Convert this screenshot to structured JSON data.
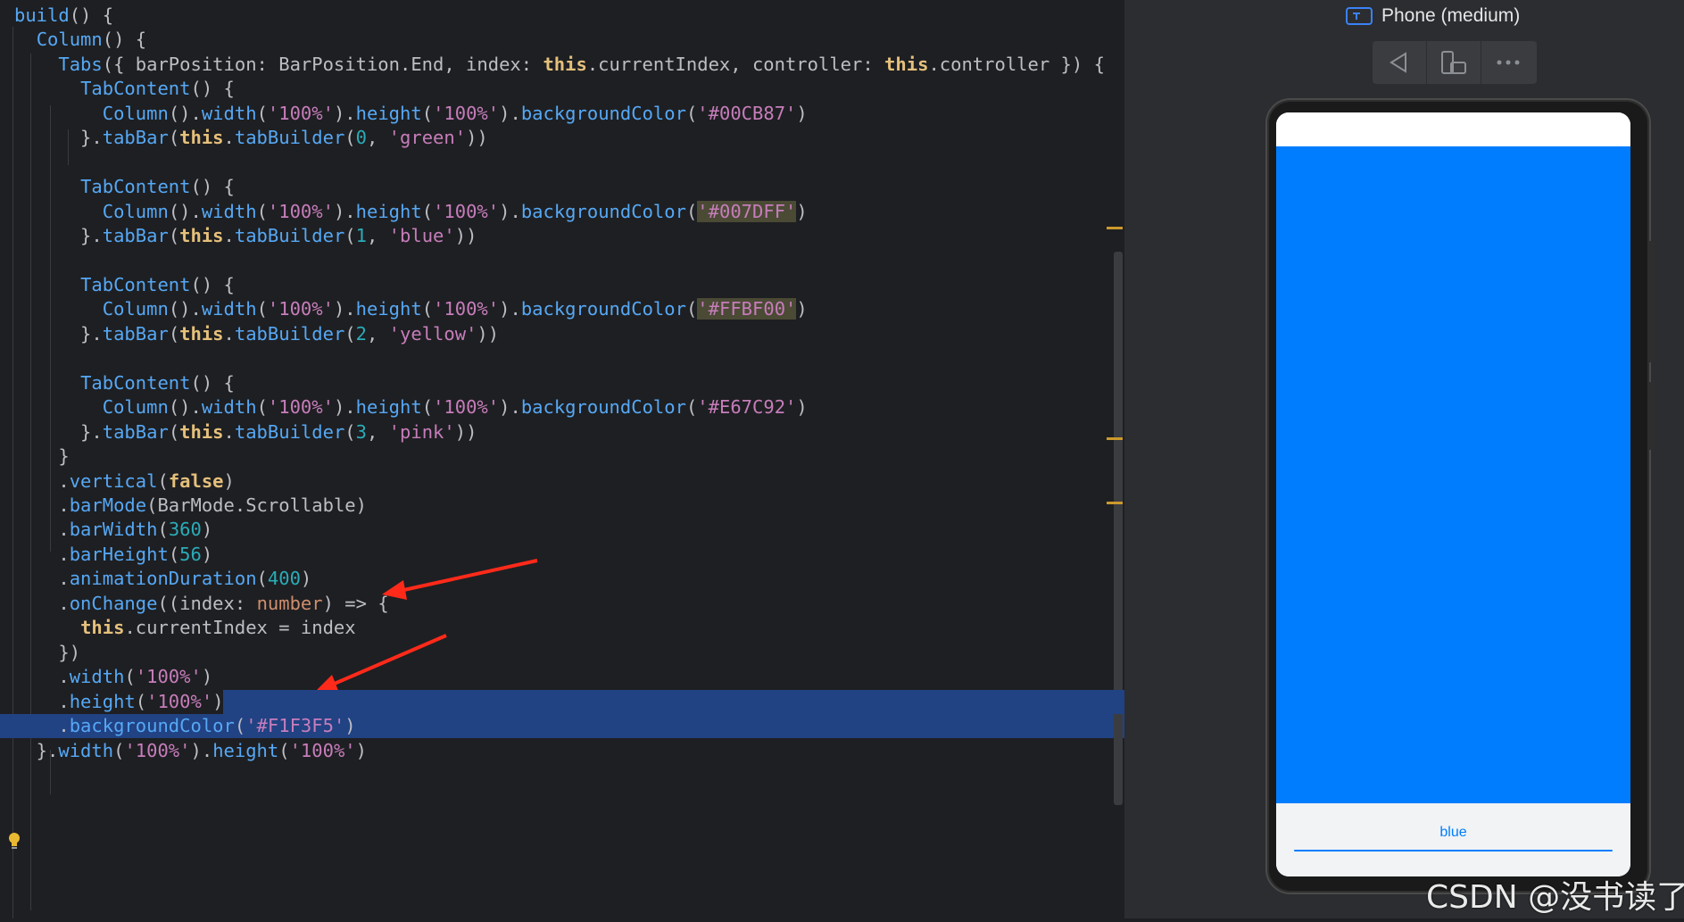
{
  "editor": {
    "lines": [
      [
        [
          "fn",
          "build"
        ],
        [
          "pun",
          "() {"
        ]
      ],
      [
        [
          "pun",
          "  "
        ],
        [
          "cls",
          "Column"
        ],
        [
          "pun",
          "() {"
        ]
      ],
      [
        [
          "pun",
          "    "
        ],
        [
          "cls",
          "Tabs"
        ],
        [
          "pun",
          "({ barPosition: BarPosition.End, index: "
        ],
        [
          "kw",
          "this"
        ],
        [
          "pun",
          ".currentIndex, controller: "
        ],
        [
          "kw",
          "this"
        ],
        [
          "pun",
          ".controller }) {"
        ]
      ],
      [
        [
          "pun",
          "      "
        ],
        [
          "cls",
          "TabContent"
        ],
        [
          "pun",
          "() {"
        ]
      ],
      [
        [
          "pun",
          "        "
        ],
        [
          "cls",
          "Column"
        ],
        [
          "pun",
          "()."
        ],
        [
          "fn",
          "width"
        ],
        [
          "pun",
          "("
        ],
        [
          "strp",
          "'100%'"
        ],
        [
          "pun",
          ")."
        ],
        [
          "fn",
          "height"
        ],
        [
          "pun",
          "("
        ],
        [
          "strp",
          "'100%'"
        ],
        [
          "pun",
          ")."
        ],
        [
          "fn",
          "backgroundColor"
        ],
        [
          "pun",
          "("
        ],
        [
          "strp",
          "'#00CB87'"
        ],
        [
          "pun",
          ")"
        ]
      ],
      [
        [
          "pun",
          "      }."
        ],
        [
          "fn",
          "tabBar"
        ],
        [
          "pun",
          "("
        ],
        [
          "kw",
          "this"
        ],
        [
          "pun",
          "."
        ],
        [
          "fn",
          "tabBuilder"
        ],
        [
          "pun",
          "("
        ],
        [
          "num",
          "0"
        ],
        [
          "pun",
          ", "
        ],
        [
          "strp",
          "'green'"
        ],
        [
          "pun",
          "))"
        ]
      ],
      [
        [
          "pun",
          ""
        ]
      ],
      [
        [
          "pun",
          "      "
        ],
        [
          "cls",
          "TabContent"
        ],
        [
          "pun",
          "() {"
        ]
      ],
      [
        [
          "pun",
          "        "
        ],
        [
          "cls",
          "Column"
        ],
        [
          "pun",
          "()."
        ],
        [
          "fn",
          "width"
        ],
        [
          "pun",
          "("
        ],
        [
          "strp",
          "'100%'"
        ],
        [
          "pun",
          ")."
        ],
        [
          "fn",
          "height"
        ],
        [
          "pun",
          "("
        ],
        [
          "strp",
          "'100%'"
        ],
        [
          "pun",
          ")."
        ],
        [
          "fn",
          "backgroundColor"
        ],
        [
          "pun",
          "("
        ],
        [
          "hl-str",
          "'#007DFF'"
        ],
        [
          "pun",
          ")"
        ]
      ],
      [
        [
          "pun",
          "      }."
        ],
        [
          "fn",
          "tabBar"
        ],
        [
          "pun",
          "("
        ],
        [
          "kw",
          "this"
        ],
        [
          "pun",
          "."
        ],
        [
          "fn",
          "tabBuilder"
        ],
        [
          "pun",
          "("
        ],
        [
          "num",
          "1"
        ],
        [
          "pun",
          ", "
        ],
        [
          "strp",
          "'blue'"
        ],
        [
          "pun",
          "))"
        ]
      ],
      [
        [
          "pun",
          ""
        ]
      ],
      [
        [
          "pun",
          "      "
        ],
        [
          "cls",
          "TabContent"
        ],
        [
          "pun",
          "() {"
        ]
      ],
      [
        [
          "pun",
          "        "
        ],
        [
          "cls",
          "Column"
        ],
        [
          "pun",
          "()."
        ],
        [
          "fn",
          "width"
        ],
        [
          "pun",
          "("
        ],
        [
          "strp",
          "'100%'"
        ],
        [
          "pun",
          ")."
        ],
        [
          "fn",
          "height"
        ],
        [
          "pun",
          "("
        ],
        [
          "strp",
          "'100%'"
        ],
        [
          "pun",
          ")."
        ],
        [
          "fn",
          "backgroundColor"
        ],
        [
          "pun",
          "("
        ],
        [
          "hl-str",
          "'#FFBF00'"
        ],
        [
          "pun",
          ")"
        ]
      ],
      [
        [
          "pun",
          "      }."
        ],
        [
          "fn",
          "tabBar"
        ],
        [
          "pun",
          "("
        ],
        [
          "kw",
          "this"
        ],
        [
          "pun",
          "."
        ],
        [
          "fn",
          "tabBuilder"
        ],
        [
          "pun",
          "("
        ],
        [
          "num",
          "2"
        ],
        [
          "pun",
          ", "
        ],
        [
          "strp",
          "'yellow'"
        ],
        [
          "pun",
          "))"
        ]
      ],
      [
        [
          "pun",
          ""
        ]
      ],
      [
        [
          "pun",
          "      "
        ],
        [
          "cls",
          "TabContent"
        ],
        [
          "pun",
          "() {"
        ]
      ],
      [
        [
          "pun",
          "        "
        ],
        [
          "cls",
          "Column"
        ],
        [
          "pun",
          "()."
        ],
        [
          "fn",
          "width"
        ],
        [
          "pun",
          "("
        ],
        [
          "strp",
          "'100%'"
        ],
        [
          "pun",
          ")."
        ],
        [
          "fn",
          "height"
        ],
        [
          "pun",
          "("
        ],
        [
          "strp",
          "'100%'"
        ],
        [
          "pun",
          ")."
        ],
        [
          "fn",
          "backgroundColor"
        ],
        [
          "pun",
          "("
        ],
        [
          "strp",
          "'#E67C92'"
        ],
        [
          "pun",
          ")"
        ]
      ],
      [
        [
          "pun",
          "      }."
        ],
        [
          "fn",
          "tabBar"
        ],
        [
          "pun",
          "("
        ],
        [
          "kw",
          "this"
        ],
        [
          "pun",
          "."
        ],
        [
          "fn",
          "tabBuilder"
        ],
        [
          "pun",
          "("
        ],
        [
          "num",
          "3"
        ],
        [
          "pun",
          ", "
        ],
        [
          "strp",
          "'pink'"
        ],
        [
          "pun",
          "))"
        ]
      ],
      [
        [
          "pun",
          "    }"
        ]
      ],
      [
        [
          "pun",
          "    ."
        ],
        [
          "fn",
          "vertical"
        ],
        [
          "pun",
          "("
        ],
        [
          "kw",
          "false"
        ],
        [
          "pun",
          ")"
        ]
      ],
      [
        [
          "pun",
          "    ."
        ],
        [
          "fn",
          "barMode"
        ],
        [
          "pun",
          "(BarMode.Scrollable)"
        ]
      ],
      [
        [
          "pun",
          "    ."
        ],
        [
          "fn",
          "barWidth"
        ],
        [
          "pun",
          "("
        ],
        [
          "num",
          "360"
        ],
        [
          "pun",
          ")"
        ]
      ],
      [
        [
          "pun",
          "    ."
        ],
        [
          "fn",
          "barHeight"
        ],
        [
          "pun",
          "("
        ],
        [
          "num",
          "56"
        ],
        [
          "pun",
          ")"
        ]
      ],
      [
        [
          "pun",
          "    ."
        ],
        [
          "fn",
          "animationDuration"
        ],
        [
          "pun",
          "("
        ],
        [
          "num",
          "400"
        ],
        [
          "pun",
          ")"
        ]
      ],
      [
        [
          "pun",
          "    ."
        ],
        [
          "fn",
          "onChange"
        ],
        [
          "pun",
          "((index: "
        ],
        [
          "typ",
          "number"
        ],
        [
          "pun",
          ") => {"
        ]
      ],
      [
        [
          "pun",
          "      "
        ],
        [
          "kw",
          "this"
        ],
        [
          "pun",
          ".currentIndex = index"
        ]
      ],
      [
        [
          "pun",
          "    })"
        ]
      ],
      [
        [
          "pun",
          "    ."
        ],
        [
          "fn",
          "width"
        ],
        [
          "pun",
          "("
        ],
        [
          "strp",
          "'100%'"
        ],
        [
          "pun",
          ")"
        ]
      ],
      [
        [
          "pun",
          "    ."
        ],
        [
          "fn",
          "height"
        ],
        [
          "pun",
          "("
        ],
        [
          "strp",
          "'100%'"
        ],
        [
          "pun",
          ")"
        ]
      ],
      [
        [
          "pun",
          "    ."
        ],
        [
          "fn",
          "backgroundColor"
        ],
        [
          "pun",
          "("
        ],
        [
          "strp",
          "'#F1F3F5'"
        ],
        [
          "pun",
          ")"
        ]
      ],
      [
        [
          "pun",
          "  }."
        ],
        [
          "fn",
          "width"
        ],
        [
          "pun",
          "("
        ],
        [
          "strp",
          "'100%'"
        ],
        [
          "pun",
          ")."
        ],
        [
          "fn",
          "height"
        ],
        [
          "pun",
          "("
        ],
        [
          "strp",
          "'100%'"
        ],
        [
          "pun",
          ")"
        ]
      ]
    ]
  },
  "preview": {
    "device_title": "Phone (medium)",
    "toolbar": [
      "back-icon",
      "rotate-device-icon",
      "more-icon"
    ],
    "tab_content_color": "#007DFF",
    "tabbar_color": "#F1F3F5",
    "tab_label": "blue"
  },
  "watermark": "CSDN @没书读了"
}
